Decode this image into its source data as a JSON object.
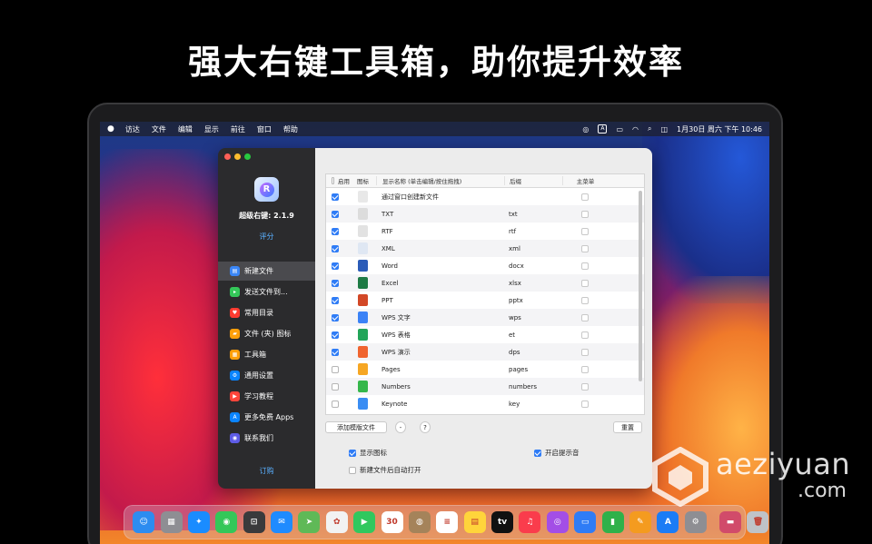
{
  "headline": "强大右键工具箱，助你提升效率",
  "menubar": {
    "items": [
      "访达",
      "文件",
      "编辑",
      "显示",
      "前往",
      "窗口",
      "帮助"
    ],
    "clock": "1月30日 周六 下午 10:46",
    "input_badge": "A"
  },
  "app": {
    "name": "超级右键: 2.1.9",
    "rate_label": "评分",
    "buy_label": "订购",
    "icon_letter": "R"
  },
  "sidebar": {
    "items": [
      {
        "label": "新建文件",
        "icon": "new-file-icon",
        "color": "#3a86f7"
      },
      {
        "label": "发送文件到...",
        "icon": "send-file-icon",
        "color": "#34c759"
      },
      {
        "label": "常用目录",
        "icon": "heart-folder-icon",
        "color": "#ff3b30"
      },
      {
        "label": "文件 (夹) 图标",
        "icon": "folder-icon-icon",
        "color": "#ff9f0a"
      },
      {
        "label": "工具箱",
        "icon": "toolbox-icon",
        "color": "#ff9f0a"
      },
      {
        "label": "通用设置",
        "icon": "settings-icon",
        "color": "#0a84ff"
      },
      {
        "label": "学习教程",
        "icon": "tutorial-icon",
        "color": "#ff453a"
      },
      {
        "label": "更多免费 Apps",
        "icon": "app-store-icon",
        "color": "#0a84ff"
      },
      {
        "label": "联系我们",
        "icon": "contact-icon",
        "color": "#5e5ce6"
      }
    ]
  },
  "table": {
    "headers": {
      "enabled": "启用",
      "icon": "图标",
      "name": "显示名称 (单击编辑/按住拖拽)",
      "suffix": "后缀",
      "main_menu": "主菜单"
    },
    "rows": [
      {
        "enabled": true,
        "icon": "blank-file-icon",
        "color": "#e8e8e8",
        "name": "通过窗口创建新文件",
        "suffix": ""
      },
      {
        "enabled": true,
        "icon": "txt-file-icon",
        "color": "#dcdcdc",
        "name": "TXT",
        "suffix": "txt"
      },
      {
        "enabled": true,
        "icon": "rtf-file-icon",
        "color": "#e2e2e2",
        "name": "RTF",
        "suffix": "rtf"
      },
      {
        "enabled": true,
        "icon": "xml-file-icon",
        "color": "#dfe7f3",
        "name": "XML",
        "suffix": "xml"
      },
      {
        "enabled": true,
        "icon": "word-icon",
        "color": "#2b5cb8",
        "name": "Word",
        "suffix": "docx"
      },
      {
        "enabled": true,
        "icon": "excel-icon",
        "color": "#1e7a45",
        "name": "Excel",
        "suffix": "xlsx"
      },
      {
        "enabled": true,
        "icon": "powerpoint-icon",
        "color": "#d24726",
        "name": "PPT",
        "suffix": "pptx"
      },
      {
        "enabled": true,
        "icon": "wps-writer-icon",
        "color": "#3b82f6",
        "name": "WPS 文字",
        "suffix": "wps"
      },
      {
        "enabled": true,
        "icon": "wps-sheet-icon",
        "color": "#22a559",
        "name": "WPS 表格",
        "suffix": "et"
      },
      {
        "enabled": true,
        "icon": "wps-slides-icon",
        "color": "#f0642f",
        "name": "WPS 演示",
        "suffix": "dps"
      },
      {
        "enabled": false,
        "icon": "pages-icon",
        "color": "#f6a623",
        "name": "Pages",
        "suffix": "pages"
      },
      {
        "enabled": false,
        "icon": "numbers-icon",
        "color": "#35b74b",
        "name": "Numbers",
        "suffix": "numbers"
      },
      {
        "enabled": false,
        "icon": "keynote-icon",
        "color": "#3a8df3",
        "name": "Keynote",
        "suffix": "key"
      }
    ]
  },
  "buttons": {
    "add_template": "添加模版文件",
    "minus": "-",
    "help": "?",
    "reset": "重置"
  },
  "options": {
    "show_icon": {
      "label": "显示图标",
      "checked": true
    },
    "sound": {
      "label": "开启提示音",
      "checked": true
    },
    "auto_open": {
      "label": "新建文件后自动打开",
      "checked": false
    }
  },
  "dock": {
    "apps": [
      {
        "icon": "finder-icon",
        "color": "#2d8cf0",
        "glyph": "☺"
      },
      {
        "icon": "launchpad-icon",
        "color": "#8e8e93",
        "glyph": "▦"
      },
      {
        "icon": "safari-icon",
        "color": "#1a8cff",
        "glyph": "✦"
      },
      {
        "icon": "messages-icon",
        "color": "#34c759",
        "glyph": "◉"
      },
      {
        "icon": "screenshot-icon",
        "color": "#3a3a3c",
        "glyph": "⊡"
      },
      {
        "icon": "mail-icon",
        "color": "#1f8bff",
        "glyph": "✉"
      },
      {
        "icon": "maps-icon",
        "color": "#5fb957",
        "glyph": "➤"
      },
      {
        "icon": "photos-icon",
        "color": "#f2f2f2",
        "glyph": "✿"
      },
      {
        "icon": "facetime-icon",
        "color": "#30c85e",
        "glyph": "▶"
      },
      {
        "icon": "calendar-icon",
        "color": "#ffffff",
        "glyph": "30"
      },
      {
        "icon": "contacts-icon",
        "color": "#a5835a",
        "glyph": "◍"
      },
      {
        "icon": "reminders-icon",
        "color": "#ffffff",
        "glyph": "≡"
      },
      {
        "icon": "notes-icon",
        "color": "#ffd43b",
        "glyph": "▤"
      },
      {
        "icon": "apple-tv-icon",
        "color": "#111111",
        "glyph": "tv"
      },
      {
        "icon": "music-icon",
        "color": "#fa3c4c",
        "glyph": "♫"
      },
      {
        "icon": "podcasts-icon",
        "color": "#a34ee6",
        "glyph": "◎"
      },
      {
        "icon": "keynote-dock-icon",
        "color": "#2f7cf6",
        "glyph": "▭"
      },
      {
        "icon": "numbers-dock-icon",
        "color": "#2fb14a",
        "glyph": "▮"
      },
      {
        "icon": "pages-dock-icon",
        "color": "#f49b1f",
        "glyph": "✎"
      },
      {
        "icon": "app-store-dock-icon",
        "color": "#1b7cf5",
        "glyph": "A"
      },
      {
        "icon": "system-preferences-icon",
        "color": "#8e8e93",
        "glyph": "⚙"
      }
    ],
    "extras": [
      {
        "icon": "finder-window-icon",
        "color": "#d14b6a",
        "glyph": "▬"
      },
      {
        "icon": "trash-icon",
        "color": "#bfc3c8",
        "glyph": "🗑"
      }
    ]
  },
  "watermark": {
    "brand": "aeziyuan",
    "suffix": ".com"
  }
}
